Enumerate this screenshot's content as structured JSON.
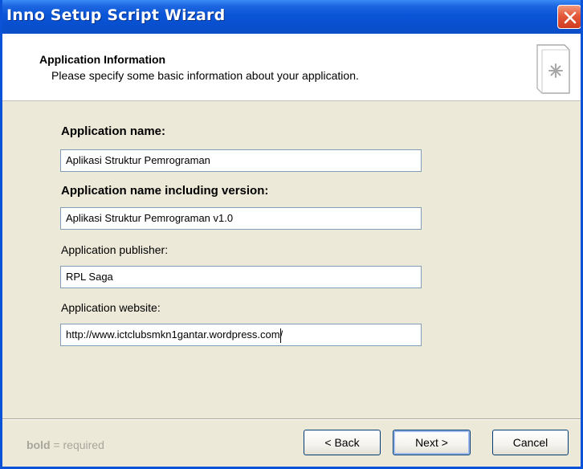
{
  "window": {
    "title": "Inno Setup Script Wizard"
  },
  "header": {
    "heading": "Application Information",
    "subheading": "Please specify some basic information about your application.",
    "icon": "wizard-document-icon"
  },
  "form": {
    "app_name": {
      "label": "Application name:",
      "value": "Aplikasi Struktur Pemrograman",
      "required": true
    },
    "app_version": {
      "label": "Application name including version:",
      "value": "Aplikasi Struktur Pemrograman v1.0",
      "required": true
    },
    "publisher": {
      "label": "Application publisher:",
      "value": "RPL Saga",
      "required": false
    },
    "website": {
      "label": "Application website:",
      "value": "http://www.ictclubsmkn1gantar.wordpress.com/",
      "required": false
    }
  },
  "footer": {
    "note_bold": "bold",
    "note_rest": " = required",
    "back_label": "< Back",
    "next_label": "Next >",
    "cancel_label": "Cancel"
  },
  "colors": {
    "titlebar": "#0a55d8",
    "dialog_bg": "#ece9d8",
    "close_button": "#e4573a",
    "input_border": "#7f9db9"
  }
}
